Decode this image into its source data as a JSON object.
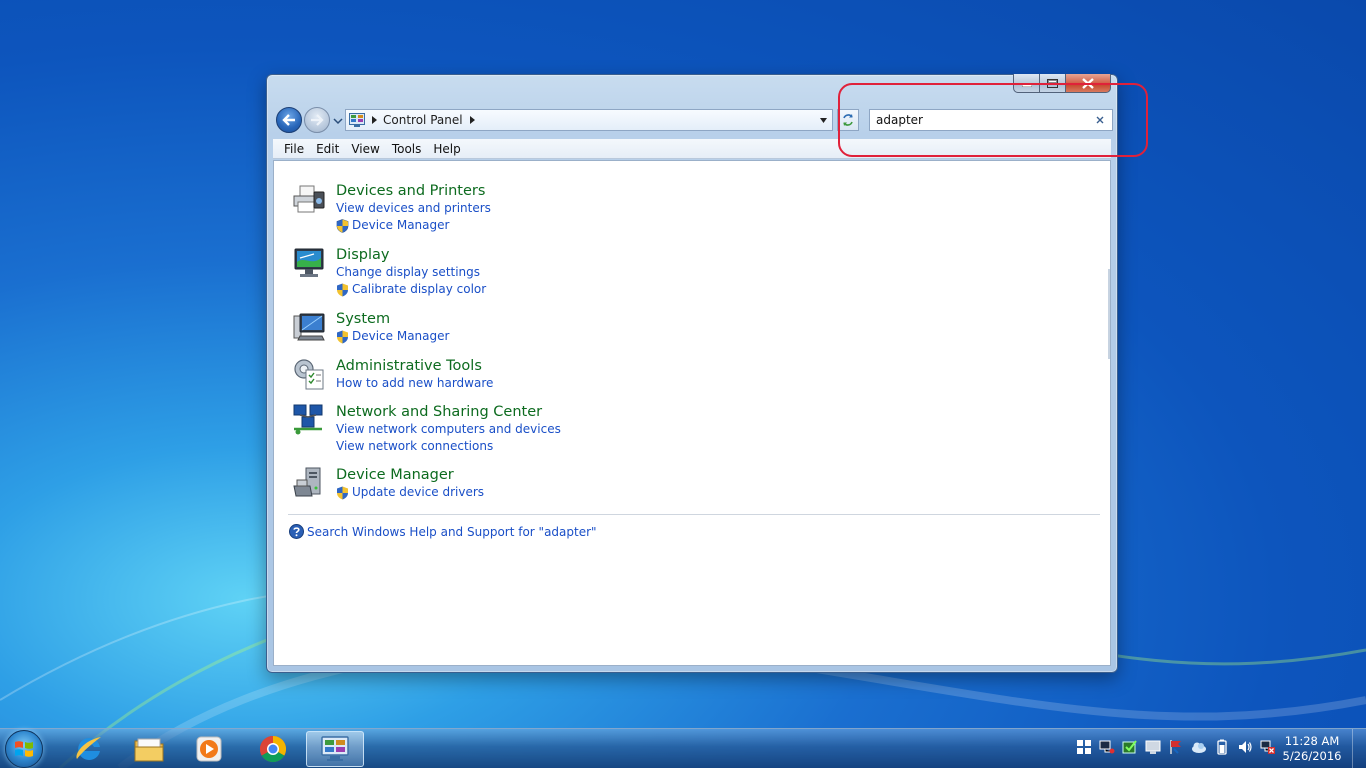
{
  "window": {
    "breadcrumb": [
      "Control Panel"
    ],
    "search": {
      "value": "adapter"
    },
    "menu": [
      "File",
      "Edit",
      "View",
      "Tools",
      "Help"
    ]
  },
  "results": [
    {
      "title": "Devices and Printers",
      "icon": "printer-icon",
      "links": [
        {
          "label": "View devices and printers",
          "shield": false
        },
        {
          "label": "Device Manager",
          "shield": true
        }
      ]
    },
    {
      "title": "Display",
      "icon": "monitor-icon",
      "links": [
        {
          "label": "Change display settings",
          "shield": false
        },
        {
          "label": "Calibrate display color",
          "shield": true
        }
      ]
    },
    {
      "title": "System",
      "icon": "computer-icon",
      "links": [
        {
          "label": "Device Manager",
          "shield": true
        }
      ]
    },
    {
      "title": "Administrative Tools",
      "icon": "admin-tools-icon",
      "links": [
        {
          "label": "How to add new hardware",
          "shield": false
        }
      ]
    },
    {
      "title": "Network and Sharing Center",
      "icon": "network-icon",
      "links": [
        {
          "label": "View network computers and devices",
          "shield": false
        },
        {
          "label": "View network connections",
          "shield": false
        }
      ]
    },
    {
      "title": "Device Manager",
      "icon": "device-manager-icon",
      "links": [
        {
          "label": "Update device drivers",
          "shield": true
        }
      ]
    }
  ],
  "help_search": "Search Windows Help and Support for \"adapter\"",
  "taskbar": {
    "apps": [
      "internet-explorer-icon",
      "file-explorer-icon",
      "media-player-icon",
      "chrome-icon",
      "control-panel-icon"
    ],
    "clock": {
      "time": "11:28 AM",
      "date": "5/26/2016"
    }
  },
  "colors": {
    "accent_green": "#0d6b1f",
    "link_blue": "#1a4fc7",
    "annotation_red": "#e0213a"
  }
}
